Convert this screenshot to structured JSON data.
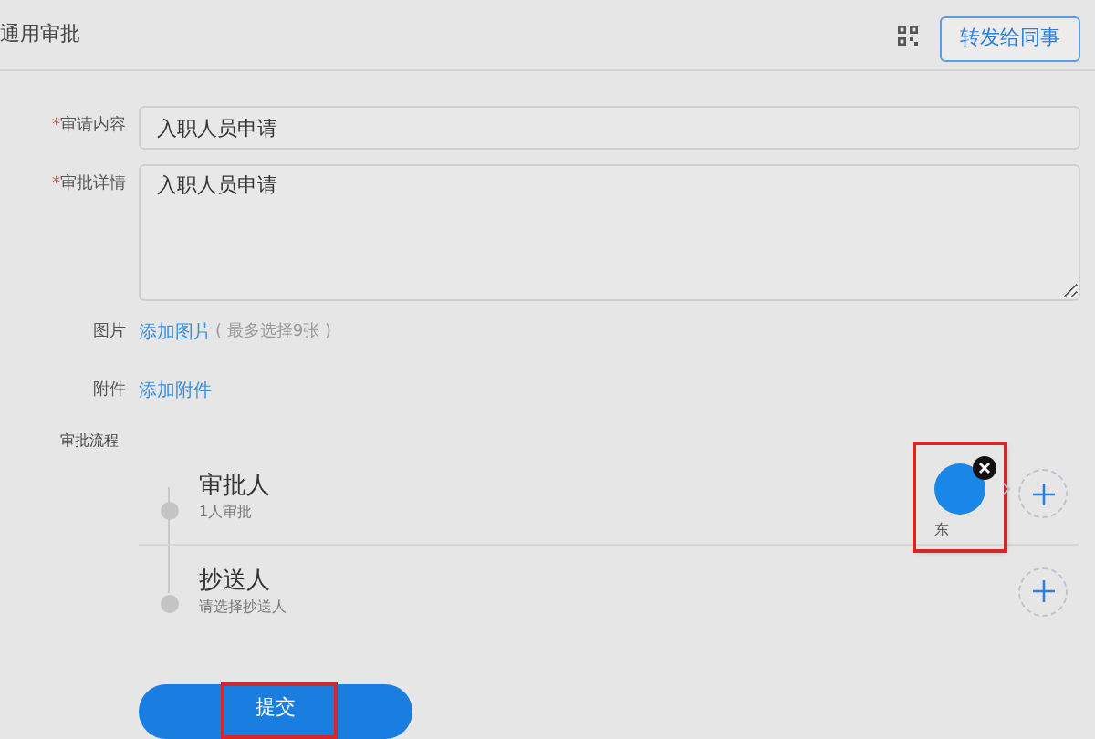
{
  "header": {
    "title": "通用审批",
    "forward_button": "转发给同事"
  },
  "fields": [
    {
      "kind": "input",
      "label": "审请内容",
      "required_mark": "*",
      "value": "入职人员申请"
    },
    {
      "kind": "textarea",
      "label": "审批详情",
      "required_mark": "*",
      "value": "入职人员申请"
    }
  ],
  "attachments": [
    {
      "label": "图片",
      "link": "添加图片",
      "hint": "( 最多选择9张 )"
    },
    {
      "label": "附件",
      "link": "添加附件"
    }
  ],
  "flow": {
    "label": "审批流程",
    "steps": [
      {
        "title": "审批人",
        "subtitle": "1人审批",
        "highlighted": true,
        "people": [
          {
            "name": "东",
            "color": "#1a86e8"
          }
        ]
      },
      {
        "title": "抄送人",
        "subtitle": "请选择抄送人",
        "highlighted": false
      }
    ]
  },
  "submit": {
    "label": "提交",
    "highlighted": true
  }
}
